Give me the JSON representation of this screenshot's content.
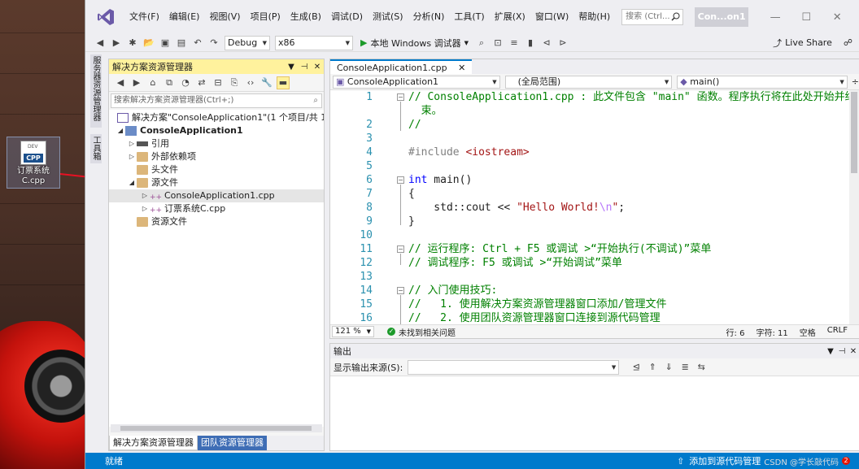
{
  "desktop": {
    "icon_badge": "CPP",
    "icon_label_line1": "订票系统",
    "icon_label_line2": "C.cpp",
    "icon_top_text": "DEV"
  },
  "menu": [
    "文件(F)",
    "编辑(E)",
    "视图(V)",
    "项目(P)",
    "生成(B)",
    "调试(D)",
    "测试(S)",
    "分析(N)",
    "工具(T)",
    "扩展(X)",
    "窗口(W)",
    "帮助(H)"
  ],
  "search": {
    "placeholder": "搜索 (Ctrl..."
  },
  "project_title": "Con...on1",
  "toolbar": {
    "config": "Debug",
    "platform": "x86",
    "run_label": "本地 Windows 调试器",
    "live_share": "Live Share"
  },
  "rail_tabs": [
    "服务器资源管理器",
    "工具箱"
  ],
  "solution_explorer": {
    "title": "解决方案资源管理器",
    "search_placeholder": "搜索解决方案资源管理器(Ctrl+;)",
    "nodes": [
      {
        "label": "解决方案\"ConsoleApplication1\"(1 个项目/共 1 个"
      },
      {
        "label": "ConsoleApplication1"
      },
      {
        "label": "引用"
      },
      {
        "label": "外部依赖项"
      },
      {
        "label": "头文件"
      },
      {
        "label": "源文件"
      },
      {
        "label": "ConsoleApplication1.cpp"
      },
      {
        "label": "订票系统C.cpp"
      },
      {
        "label": "资源文件"
      }
    ],
    "bottom_tabs": [
      "解决方案资源管理器",
      "团队资源管理器"
    ]
  },
  "editor": {
    "tab": "ConsoleApplication1.cpp",
    "nav_project": "ConsoleApplication1",
    "nav_scope": "(全局范围)",
    "nav_member": "main()",
    "line_numbers": [
      "1",
      "",
      "2",
      "3",
      "4",
      "5",
      "6",
      "7",
      "8",
      "9",
      "10",
      "11",
      "12",
      "13",
      "14",
      "15",
      "16"
    ],
    "code": {
      "l1": "// ConsoleApplication1.cpp : 此文件包含 \"main\" 函数。程序执行将在此处开始并结",
      "l1b": "  束。",
      "l2": "//",
      "l4_pre": "#include ",
      "l4_inc": "<iostream>",
      "l6_kw": "int",
      "l6_rest": " main()",
      "l7": "{",
      "l8_a": "    std::cout << ",
      "l8_str": "\"Hello World!",
      "l8_esc": "\\n",
      "l8_end": "\"",
      "l8_semi": ";",
      "l9": "}",
      "l11": "// 运行程序: Ctrl + F5 或调试 >“开始执行(不调试)”菜单",
      "l12": "// 调试程序: F5 或调试 >“开始调试”菜单",
      "l14": "// 入门使用技巧:",
      "l15": "//   1. 使用解决方案资源管理器窗口添加/管理文件",
      "l16": "//   2. 使用团队资源管理器窗口连接到源代码管理"
    },
    "zoom": "121 %",
    "issues": "未找到相关问题",
    "row": "行: 6",
    "col": "字符: 11",
    "ws": "空格",
    "eol": "CRLF"
  },
  "output": {
    "title": "输出",
    "source_label": "显示输出来源(S):"
  },
  "statusbar": {
    "ready": "就绪",
    "add_source": "添加到源代码管理",
    "watermark": "CSDN @学长敲代码",
    "badge": "2",
    "color": "#007acc"
  }
}
